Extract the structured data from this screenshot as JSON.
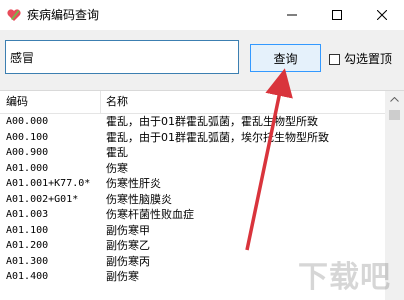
{
  "window": {
    "title": "疾病编码查询",
    "icon": "heart-pen-icon",
    "controls": [
      "minimize-icon",
      "maximize-icon",
      "close-icon"
    ]
  },
  "toolbar": {
    "search_value": "感冒",
    "query_button_label": "查询",
    "pin_top_label": "勾选置顶",
    "pin_top_checked": false
  },
  "table": {
    "columns": [
      "编码",
      "名称"
    ],
    "rows": [
      {
        "code": "A00.000",
        "name": "霍乱，由于01群霍乱弧菌，霍乱生物型所致"
      },
      {
        "code": "A00.100",
        "name": "霍乱，由于01群霍乱弧菌，埃尔托生物型所致"
      },
      {
        "code": "A00.900",
        "name": "霍乱"
      },
      {
        "code": "A01.000",
        "name": "伤寒"
      },
      {
        "code": "A01.001+K77.0*",
        "name": "伤寒性肝炎"
      },
      {
        "code": "A01.002+G01*",
        "name": "伤寒性脑膜炎"
      },
      {
        "code": "A01.003",
        "name": "伤寒杆菌性败血症"
      },
      {
        "code": "A01.100",
        "name": "副伤寒甲"
      },
      {
        "code": "A01.200",
        "name": "副伤寒乙"
      },
      {
        "code": "A01.300",
        "name": "副伤寒丙"
      },
      {
        "code": "A01.400",
        "name": "副伤寒"
      }
    ]
  },
  "colors": {
    "input_border": "#3c7fb1",
    "button_border": "#3399ff",
    "button_bg": "#e5f1fb",
    "arrow": "#d9343c"
  }
}
